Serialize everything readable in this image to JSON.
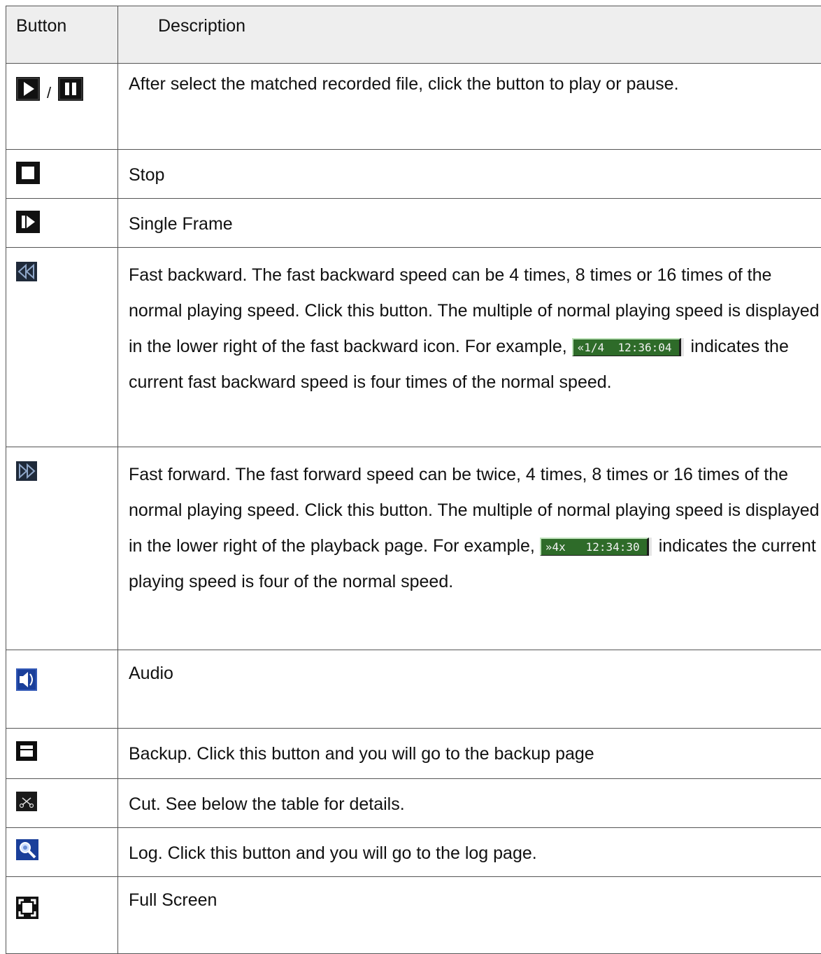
{
  "header": {
    "button": "Button",
    "description": "Description"
  },
  "rows": [
    {
      "icons": [
        "play-icon",
        "pause-icon"
      ],
      "separator": "/",
      "description": "After select the matched recorded file, click the button to play or pause."
    },
    {
      "icons": [
        "stop-icon"
      ],
      "description": "Stop"
    },
    {
      "icons": [
        "single-frame-icon"
      ],
      "description": "Single Frame"
    },
    {
      "icons": [
        "fast-backward-icon"
      ],
      "description_before": "Fast backward. The fast backward speed can be 4 times, 8 times or 16 times of the normal playing speed. Click this button. The multiple of normal playing speed is displayed in the lower right of the fast backward icon. For example,",
      "badge": "«1/4  12:36:04",
      "description_after": "indicates the current fast backward speed is four times of the normal speed."
    },
    {
      "icons": [
        "fast-forward-icon"
      ],
      "description_before": "Fast forward. The fast forward speed can be twice, 4 times, 8 times or 16 times of the normal playing speed. Click this button. The multiple of normal playing speed is displayed in the lower right of the playback page. For example,",
      "badge": "»4x   12:34:30",
      "description_after": "indicates the current playing speed is four of the normal speed."
    },
    {
      "icons": [
        "audio-icon"
      ],
      "description": "Audio"
    },
    {
      "icons": [
        "backup-icon"
      ],
      "description": "Backup. Click this button and you will go to the backup page"
    },
    {
      "icons": [
        "cut-icon"
      ],
      "description": "Cut. See below the table for details."
    },
    {
      "icons": [
        "log-icon"
      ],
      "description": "Log. Click this button and you will go to the log page."
    },
    {
      "icons": [
        "full-screen-icon"
      ],
      "description": "Full Screen"
    }
  ],
  "colors": {
    "border": "#555555",
    "header_bg": "#eeeeee",
    "badge_bg": "#2e6b29"
  }
}
